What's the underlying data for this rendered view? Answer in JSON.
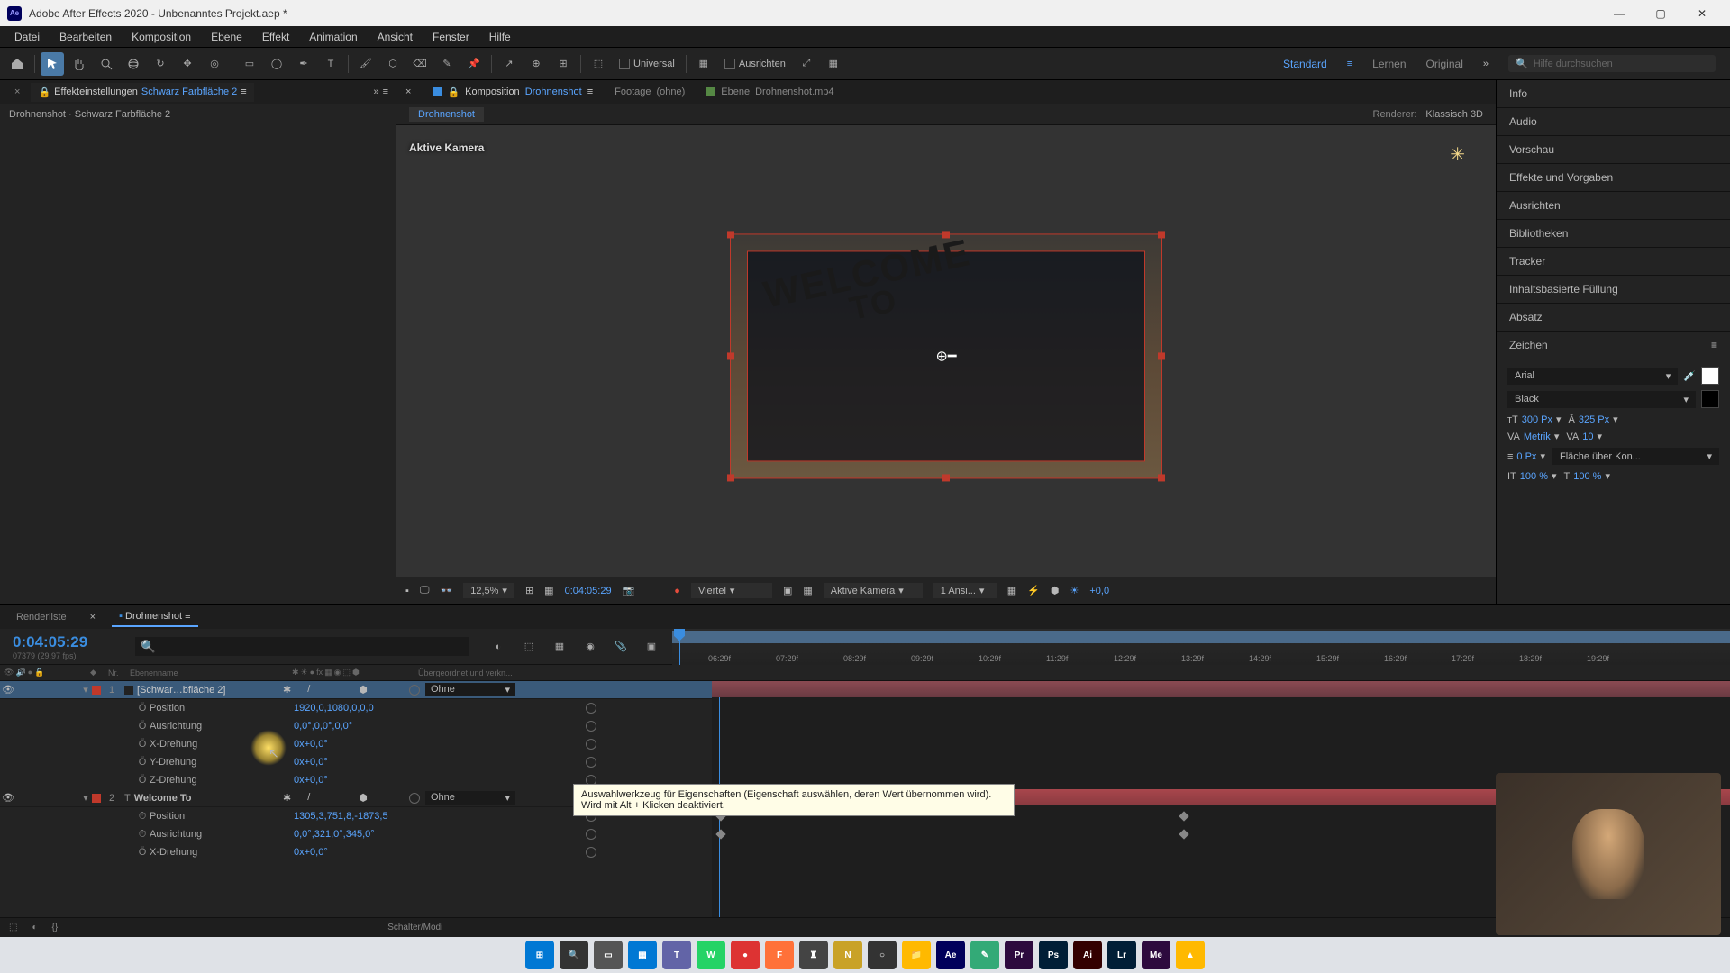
{
  "window": {
    "title": "Adobe After Effects 2020 - Unbenanntes Projekt.aep *"
  },
  "menu": [
    "Datei",
    "Bearbeiten",
    "Komposition",
    "Ebene",
    "Effekt",
    "Animation",
    "Ansicht",
    "Fenster",
    "Hilfe"
  ],
  "toolbar": {
    "universal": "Universal",
    "ausrichten": "Ausrichten",
    "workspaces": [
      "Standard",
      "Lernen",
      "Original"
    ],
    "search_placeholder": "Hilfe durchsuchen"
  },
  "left_panel": {
    "tab": "Effekteinstellungen",
    "tab_layer": "Schwarz Farbfläche 2",
    "path": "Drohnenshot · Schwarz Farbfläche 2"
  },
  "comp": {
    "tab_label": "Komposition",
    "tab_name": "Drohnenshot",
    "footage_label": "Footage",
    "footage_val": "(ohne)",
    "layer_label": "Ebene",
    "layer_val": "Drohnenshot.mp4",
    "breadcrumb": "Drohnenshot",
    "renderer_label": "Renderer:",
    "renderer_val": "Klassisch 3D",
    "aktive_kamera": "Aktive Kamera",
    "preview_text1": "WELCOME",
    "preview_text2": "TO"
  },
  "viewer_controls": {
    "zoom": "12,5%",
    "time": "0:04:05:29",
    "resolution": "Viertel",
    "camera": "Aktive Kamera",
    "views": "1 Ansi...",
    "exposure": "+0,0"
  },
  "right_panel": {
    "sections": [
      "Info",
      "Audio",
      "Vorschau",
      "Effekte und Vorgaben",
      "Ausrichten",
      "Bibliotheken",
      "Tracker",
      "Inhaltsbasierte Füllung",
      "Absatz",
      "Zeichen"
    ],
    "font": "Arial",
    "font_weight": "Black",
    "font_size": "300 Px",
    "leading": "325 Px",
    "tracking_metric": "Metrik",
    "tracking_val": "10",
    "stroke_px": "0 Px",
    "stroke_opt": "Fläche über Kon...",
    "scale_h": "100 %",
    "scale_v": "100 %"
  },
  "timeline": {
    "tab_render": "Renderliste",
    "tab_comp": "Drohnenshot",
    "current_time": "0:04:05:29",
    "frame_info": "07379 (29,97 fps)",
    "col_nr": "Nr.",
    "col_name": "Ebenenname",
    "col_parent": "Übergeordnet und verkn...",
    "ticks": [
      "06:29f",
      "07:29f",
      "08:29f",
      "09:29f",
      "10:29f",
      "11:29f",
      "12:29f",
      "13:29f",
      "14:29f",
      "15:29f",
      "16:29f",
      "17:29f",
      "18:29f",
      "19:29f"
    ],
    "layers": [
      {
        "num": "1",
        "name": "[Schwar…bfläche 2]",
        "color": "#c0392b",
        "parent": "Ohne",
        "selected": true,
        "props": [
          {
            "name": "Position",
            "val": "1920,0,1080,0,0,0"
          },
          {
            "name": "Ausrichtung",
            "val": "0,0°,0,0°,0,0°"
          },
          {
            "name": "X-Drehung",
            "val": "0x+0,0°"
          },
          {
            "name": "Y-Drehung",
            "val": "0x+0,0°"
          },
          {
            "name": "Z-Drehung",
            "val": "0x+0,0°"
          }
        ]
      },
      {
        "num": "2",
        "name": "Welcome To",
        "color": "#c0392b",
        "parent": "Ohne",
        "text_layer": true,
        "props": [
          {
            "name": "Position",
            "val": "1305,3,751,8,-1873,5",
            "kf": true
          },
          {
            "name": "Ausrichtung",
            "val": "0,0°,321,0°,345,0°",
            "kf": true
          },
          {
            "name": "X-Drehung",
            "val": "0x+0,0°"
          }
        ]
      }
    ],
    "footer_mid": "Schalter/Modi"
  },
  "tooltip": "Auswahlwerkzeug für Eigenschaften (Eigenschaft auswählen, deren Wert übernommen wird). Wird mit Alt + Klicken deaktiviert.",
  "taskbar_apps": [
    {
      "bg": "#0078d4",
      "txt": "⊞"
    },
    {
      "bg": "#333",
      "txt": "🔍"
    },
    {
      "bg": "#555",
      "txt": "▭"
    },
    {
      "bg": "#0078d4",
      "txt": "▦"
    },
    {
      "bg": "#6264a7",
      "txt": "T"
    },
    {
      "bg": "#25d366",
      "txt": "W"
    },
    {
      "bg": "#d33",
      "txt": "●"
    },
    {
      "bg": "#ff7139",
      "txt": "F"
    },
    {
      "bg": "#444",
      "txt": "♜"
    },
    {
      "bg": "#c9a227",
      "txt": "N"
    },
    {
      "bg": "#333",
      "txt": "○"
    },
    {
      "bg": "#ffb900",
      "txt": "📁"
    },
    {
      "bg": "#00005b",
      "txt": "Ae"
    },
    {
      "bg": "#3a7",
      "txt": "✎"
    },
    {
      "bg": "#2d0a3e",
      "txt": "Pr"
    },
    {
      "bg": "#001e36",
      "txt": "Ps"
    },
    {
      "bg": "#330000",
      "txt": "Ai"
    },
    {
      "bg": "#001e36",
      "txt": "Lr"
    },
    {
      "bg": "#2d0a3e",
      "txt": "Me"
    },
    {
      "bg": "#ffb900",
      "txt": "▲"
    }
  ]
}
